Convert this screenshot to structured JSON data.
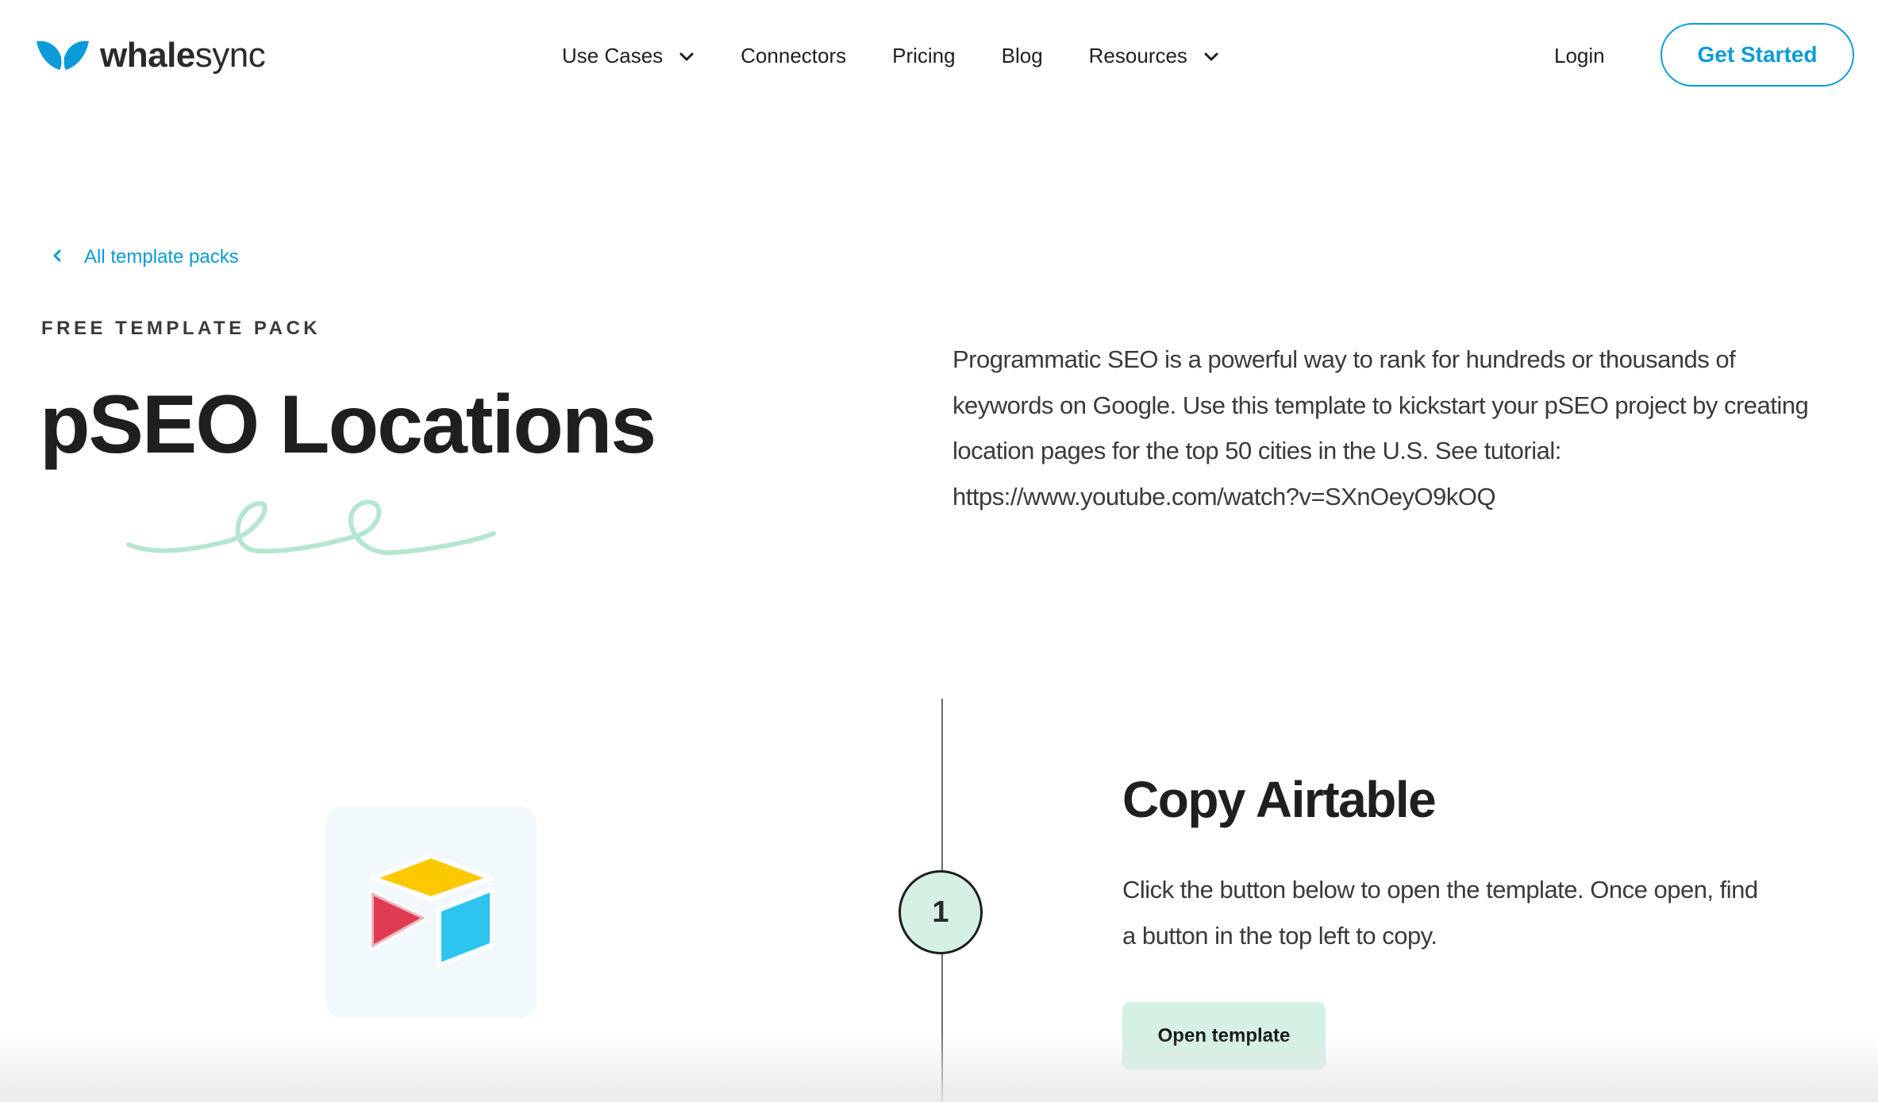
{
  "header": {
    "logo": {
      "text_bold": "whale",
      "text_regular": "sync",
      "icon": "whale-tail-icon",
      "brand_color": "#0a9bd8"
    },
    "nav": {
      "use_cases": "Use Cases",
      "connectors": "Connectors",
      "pricing": "Pricing",
      "blog": "Blog",
      "resources": "Resources"
    },
    "login": "Login",
    "get_started": "Get Started"
  },
  "breadcrumb": {
    "back_label": "All template packs",
    "icon": "chevron-left-icon"
  },
  "hero": {
    "eyebrow": "FREE TEMPLATE PACK",
    "title": "pSEO Locations",
    "description_lines": [
      "Programmatic SEO is a powerful way to rank for hundreds or thousands of",
      "keywords on Google. Use this template to kickstart your pSEO project by creating",
      "location pages for the top 50 cities in the U.S. See tutorial:",
      "https://www.youtube.com/watch?v=SXnOeyO9kOQ"
    ],
    "accent_color": "#b5e6cf"
  },
  "step": {
    "number": "1",
    "title": "Copy Airtable",
    "body_lines": [
      "Click the button below to open the template. Once open, find",
      "a button in the top left to copy."
    ],
    "button": "Open template",
    "icon": "airtable-logo-icon"
  }
}
